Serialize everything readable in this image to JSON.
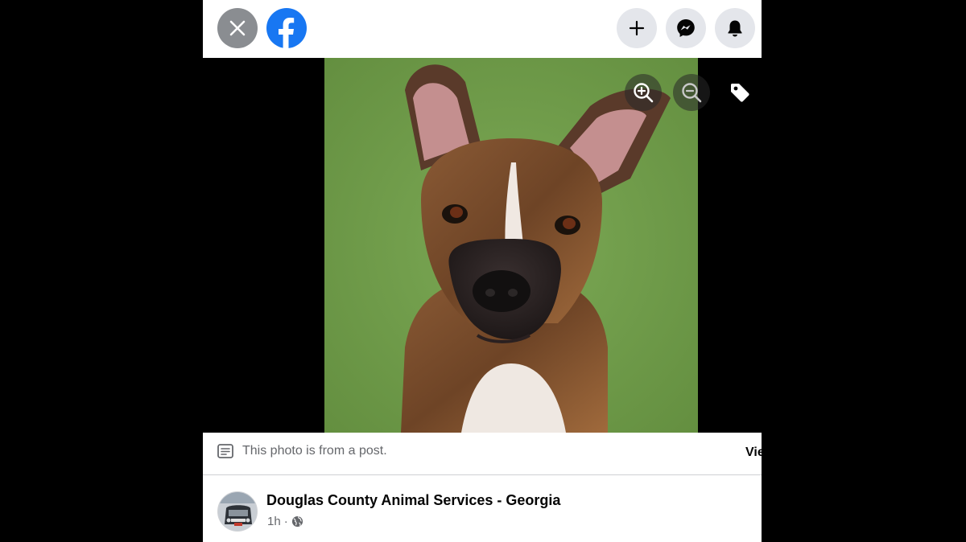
{
  "colors": {
    "facebook_blue": "#1877f2",
    "topbar_bg": "#ffffff",
    "icon_button_bg": "#e4e6eb",
    "close_button_bg": "#8a8d91",
    "secondary_text": "#65676b",
    "primary_text": "#050505"
  },
  "topbar": {
    "close_icon": "close-icon",
    "logo_icon": "facebook-logo",
    "actions": [
      {
        "icon": "plus-icon",
        "name": "create"
      },
      {
        "icon": "messenger-icon",
        "name": "messenger"
      },
      {
        "icon": "bell-icon",
        "name": "notifications"
      }
    ]
  },
  "photo": {
    "subject": "photo-dog",
    "tools": [
      {
        "icon": "zoom-in-icon"
      },
      {
        "icon": "zoom-out-icon"
      },
      {
        "icon": "tag-icon"
      }
    ]
  },
  "post_notice": {
    "icon": "post-icon",
    "text": "This photo is from a post.",
    "view_link": "Vie"
  },
  "post": {
    "author": "Douglas County Animal Services - Georgia",
    "time": "1h",
    "separator": "·",
    "privacy_icon": "globe-icon"
  }
}
